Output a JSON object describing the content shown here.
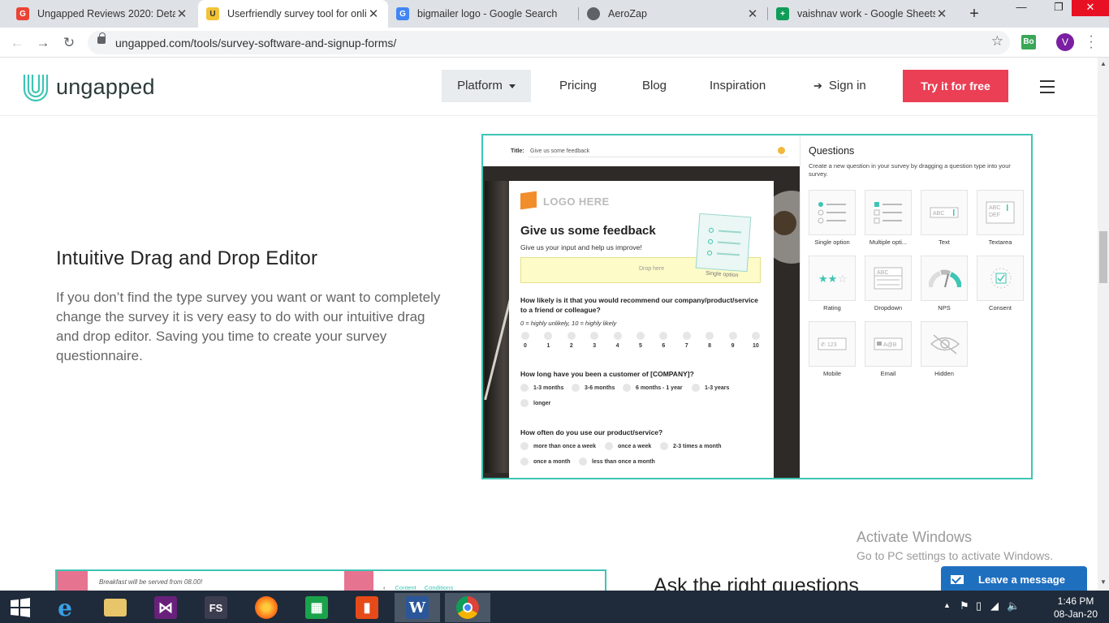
{
  "browser": {
    "tabs": [
      {
        "title": "Ungapped Reviews 2020: Detail",
        "favicon_color": "#ea4335",
        "favicon_letter": "G"
      },
      {
        "title": "Userfriendly survey tool for onli",
        "favicon_color": "#f2c335",
        "favicon_letter": "U"
      },
      {
        "title": "bigmailer logo - Google Search",
        "favicon_color": "#4285f4",
        "favicon_letter": "G"
      },
      {
        "title": "AeroZap",
        "favicon_color": "#5f6368",
        "favicon_letter": ""
      },
      {
        "title": "vaishnav work - Google Sheets",
        "favicon_color": "#0f9d58",
        "favicon_letter": "+"
      }
    ],
    "url": "ungapped.com/tools/survey-software-and-signup-forms/",
    "extension_label": "Bo",
    "profile_initial": "V"
  },
  "site": {
    "logo_text": "ungapped",
    "nav": {
      "platform": "Platform",
      "pricing": "Pricing",
      "blog": "Blog",
      "inspiration": "Inspiration",
      "signin": "Sign in",
      "cta": "Try it for free"
    },
    "accent_color": "#3ec5b4",
    "cta_color": "#ea3f55"
  },
  "feature": {
    "heading": "Intuitive Drag and Drop Editor",
    "body": "If you don’t find the type survey you want or want to completely change the survey it is very easy to do with our intuitive drag and drop editor. Saving you time to create your survey questionnaire."
  },
  "editor": {
    "title_label": "Title:",
    "title_value": "Give us some feedback",
    "form": {
      "logo_text": "LOGO HERE",
      "title": "Give us some feedback",
      "subtitle": "Give us your input and help us improve!",
      "drop_text": "Drop here",
      "drag_card_label": "Single option",
      "q1": "How likely is it that you would recommend our company/product/service to a friend or colleague?",
      "q1_hint": "0 = highly unlikely, 10 = highly likely",
      "scale": [
        "0",
        "1",
        "2",
        "3",
        "4",
        "5",
        "6",
        "7",
        "8",
        "9",
        "10"
      ],
      "q2": "How long have you been a customer of [COMPANY]?",
      "q2_options": [
        "1-3 months",
        "3-6 months",
        "6 months - 1 year",
        "1-3 years",
        "longer"
      ],
      "q3": "How often do you use our product/service?",
      "q3_options": [
        "more than once a week",
        "once a week",
        "2-3 times a month",
        "once a month",
        "less than once a month"
      ]
    },
    "questions_panel": {
      "title": "Questions",
      "description": "Create a new question in your survey by dragging a question type into your survey.",
      "types": [
        {
          "label": "Single option",
          "icon": "single-option-icon"
        },
        {
          "label": "Multiple opti...",
          "icon": "multiple-option-icon"
        },
        {
          "label": "Text",
          "icon": "text-icon"
        },
        {
          "label": "Textarea",
          "icon": "textarea-icon"
        },
        {
          "label": "Rating",
          "icon": "rating-icon"
        },
        {
          "label": "Dropdown",
          "icon": "dropdown-icon"
        },
        {
          "label": "NPS",
          "icon": "nps-icon"
        },
        {
          "label": "Consent",
          "icon": "consent-icon"
        },
        {
          "label": "Mobile",
          "icon": "mobile-icon"
        },
        {
          "label": "Email",
          "icon": "email-icon"
        },
        {
          "label": "Hidden",
          "icon": "hidden-icon"
        }
      ],
      "icon_texts": {
        "text": "ABC",
        "textarea_1": "ABC",
        "textarea_2": "DEF",
        "dropdown": "ABC",
        "mobile": "123",
        "email": "A@B"
      }
    }
  },
  "next_section": {
    "peek_text": "Breakfast will be served from 08.00!",
    "peek_tab1": "Content",
    "peek_tab2": "Conditions",
    "heading": "Ask the right questions"
  },
  "overlays": {
    "activate_title": "Activate Windows",
    "activate_sub": "Go to PC settings to activate Windows.",
    "chat_button": "Leave a message"
  },
  "taskbar": {
    "apps": [
      "windows-start",
      "internet-explorer",
      "file-explorer",
      "visual-studio",
      "fs-app",
      "firefox",
      "store",
      "office",
      "word",
      "chrome"
    ],
    "fs_label": "FS",
    "word_label": "W",
    "time": "1:46 PM",
    "date": "08-Jan-20"
  }
}
